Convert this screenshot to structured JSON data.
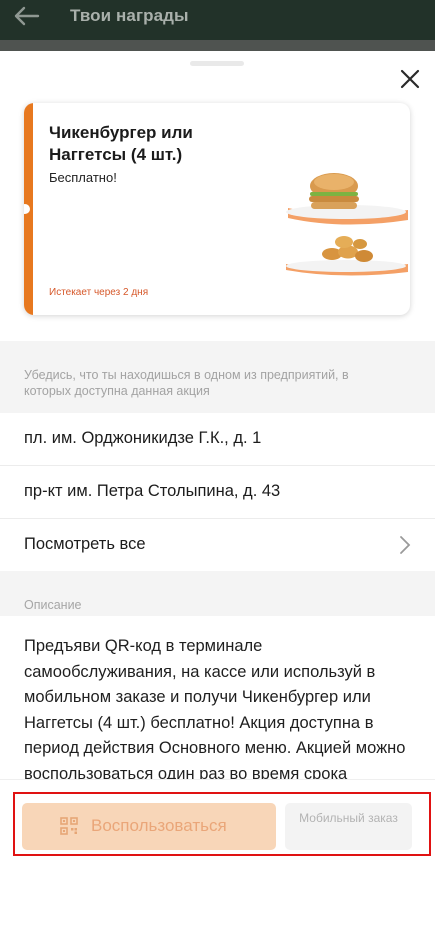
{
  "header": {
    "title": "Твои награды",
    "back_icon": "arrow-left-icon"
  },
  "sheet": {
    "close_icon": "close-icon",
    "reward": {
      "name": "Чикенбургер или Наггетсы (4 шт.)",
      "price": "Бесплатно!",
      "expires": "Истекает через 2 дня",
      "accent_color": "#e7781f"
    },
    "location_note": "Убедись, что ты находишься в одном из предприятий, в которых доступна данная акция",
    "locations": [
      "пл. им. Орджоникидзе Г.К., д. 1",
      "пр-кт им. Петра Столыпина, д. 43"
    ],
    "view_all": "Посмотреть все",
    "description_label": "Описание",
    "description": "Предъяви QR-код в терминале самообслуживания, на кассе или используй в мобильном заказе и получи Чикенбургер или Наггетсы (4 шт.) бесплатно! Акция доступна в период действия Основного меню. Акцией можно воспользоваться один раз во время срока действия. За докупленные продукты, не участвующие"
  },
  "footer": {
    "use_button": "Воспользоваться",
    "mobile_order_button": "Мобильный заказ",
    "qr_icon": "qr-code-icon"
  }
}
